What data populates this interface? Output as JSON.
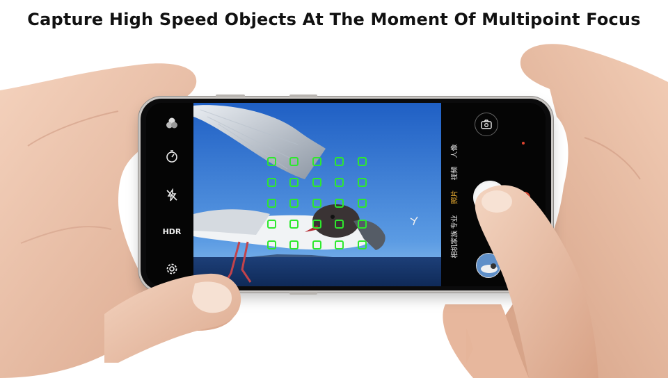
{
  "headline": "Capture High Speed Objects At The Moment Of Multipoint Focus",
  "camera": {
    "left_controls": [
      {
        "name": "filter-icon"
      },
      {
        "name": "timer-icon"
      },
      {
        "name": "flash-off-icon"
      },
      {
        "name": "hdr-icon",
        "label": "HDR"
      },
      {
        "name": "settings-icon"
      }
    ],
    "modes": [
      {
        "label": "人像",
        "active": false
      },
      {
        "label": "视频",
        "active": false
      },
      {
        "label": "照片",
        "active": true
      },
      {
        "label": "专业",
        "active": false
      },
      {
        "label": "相机家族",
        "active": false
      }
    ],
    "accent_color": "#f2b233",
    "focus_color": "#2ee82e",
    "focus_grid": {
      "rows": 5,
      "cols": 5
    }
  }
}
